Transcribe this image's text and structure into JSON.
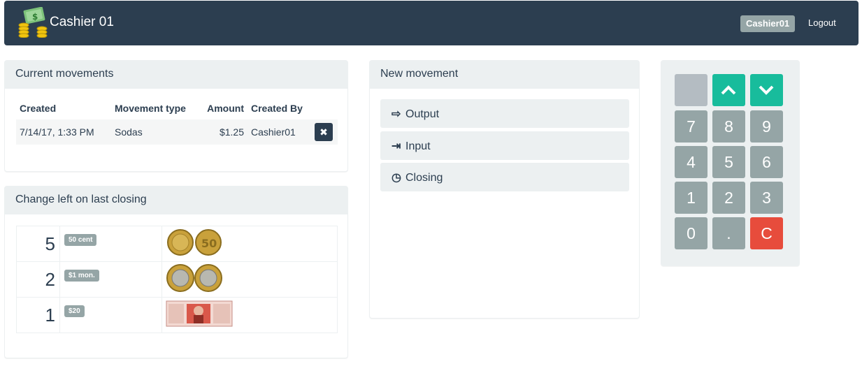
{
  "navbar": {
    "title": "Cashier 01",
    "user_badge": "Cashier01",
    "logout_label": "Logout"
  },
  "current_movements": {
    "heading": "Current movements",
    "columns": [
      "Created",
      "Movement type",
      "Amount",
      "Created By"
    ],
    "rows": [
      {
        "created": "7/14/17, 1:33 PM",
        "type": "Sodas",
        "amount": "$1.25",
        "created_by": "Cashier01"
      }
    ]
  },
  "change_left": {
    "heading": "Change left on last closing",
    "rows": [
      {
        "count": "5",
        "badge": "50 cent",
        "image": "50-cent-coins"
      },
      {
        "count": "2",
        "badge": "$1 mon.",
        "image": "1-peso-coins"
      },
      {
        "count": "1",
        "badge": "$20",
        "image": "20-peso-bill"
      }
    ]
  },
  "new_movement": {
    "heading": "New movement",
    "buttons": [
      {
        "label": "Output",
        "icon": "sign-out-icon"
      },
      {
        "label": "Input",
        "icon": "sign-in-icon"
      },
      {
        "label": "Closing",
        "icon": "clock-icon"
      }
    ]
  },
  "keypad": {
    "digits": [
      "7",
      "8",
      "9",
      "4",
      "5",
      "6",
      "1",
      "2",
      "3",
      "0",
      "."
    ],
    "clear_label": "C",
    "icons": [
      "chevron-up-icon",
      "chevron-down-icon"
    ]
  },
  "colors": {
    "navbar": "#2c3e50",
    "accent_green": "#18bc9c",
    "danger_red": "#e74c3c",
    "muted_gray": "#95a5a6",
    "panel_bg": "#ecf0f1"
  }
}
